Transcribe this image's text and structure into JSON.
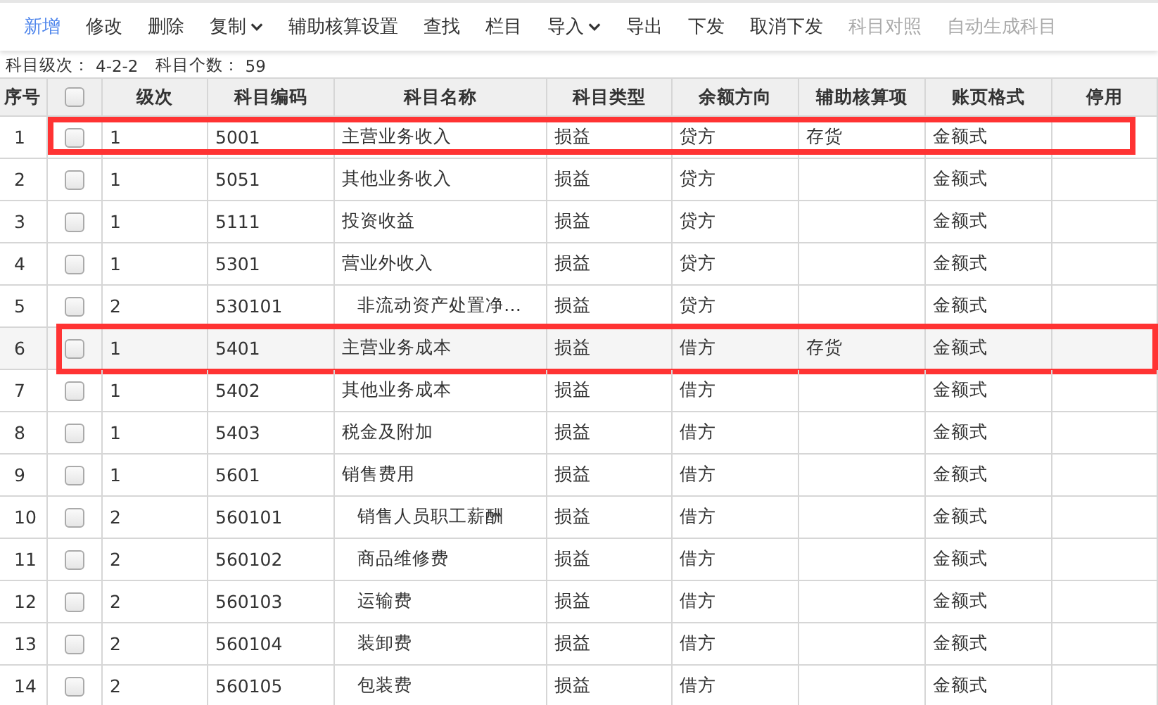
{
  "toolbar": [
    {
      "label": "新增",
      "selected": true,
      "disabled": false,
      "dropdown": false
    },
    {
      "label": "修改",
      "selected": false,
      "disabled": false,
      "dropdown": false
    },
    {
      "label": "删除",
      "selected": false,
      "disabled": false,
      "dropdown": false
    },
    {
      "label": "复制",
      "selected": false,
      "disabled": false,
      "dropdown": true
    },
    {
      "label": "辅助核算设置",
      "selected": false,
      "disabled": false,
      "dropdown": false
    },
    {
      "label": "查找",
      "selected": false,
      "disabled": false,
      "dropdown": false
    },
    {
      "label": "栏目",
      "selected": false,
      "disabled": false,
      "dropdown": false
    },
    {
      "label": "导入",
      "selected": false,
      "disabled": false,
      "dropdown": true
    },
    {
      "label": "导出",
      "selected": false,
      "disabled": false,
      "dropdown": false
    },
    {
      "label": "下发",
      "selected": false,
      "disabled": false,
      "dropdown": false
    },
    {
      "label": "取消下发",
      "selected": false,
      "disabled": false,
      "dropdown": false
    },
    {
      "label": "科目对照",
      "selected": false,
      "disabled": true,
      "dropdown": false
    },
    {
      "label": "自动生成科目",
      "selected": false,
      "disabled": true,
      "dropdown": false
    }
  ],
  "info": [
    {
      "label": "科目级次：",
      "value": "4-2-2"
    },
    {
      "label": "科目个数：",
      "value": "59"
    }
  ],
  "table": {
    "columns": [
      "序号",
      "级次",
      "科目编码",
      "科目名称",
      "科目类型",
      "余额方向",
      "辅助核算项",
      "账页格式",
      "停用"
    ],
    "header_checked": false,
    "rows": [
      {
        "no": "1",
        "checked": false,
        "level": "1",
        "code": "5001",
        "name": "主营业务收入",
        "indented": false,
        "type": "损益",
        "direction": "贷方",
        "aux": "存货",
        "format": "金额式",
        "highlighted": true,
        "hovered": false
      },
      {
        "no": "2",
        "checked": false,
        "level": "1",
        "code": "5051",
        "name": "其他业务收入",
        "indented": false,
        "type": "损益",
        "direction": "贷方",
        "aux": "",
        "format": "金额式",
        "highlighted": false,
        "hovered": false
      },
      {
        "no": "3",
        "checked": false,
        "level": "1",
        "code": "5111",
        "name": "投资收益",
        "indented": false,
        "type": "损益",
        "direction": "贷方",
        "aux": "",
        "format": "金额式",
        "highlighted": false,
        "hovered": false
      },
      {
        "no": "4",
        "checked": false,
        "level": "1",
        "code": "5301",
        "name": "营业外收入",
        "indented": false,
        "type": "损益",
        "direction": "贷方",
        "aux": "",
        "format": "金额式",
        "highlighted": false,
        "hovered": false
      },
      {
        "no": "5",
        "checked": false,
        "level": "2",
        "code": "530101",
        "name": "非流动资产处置净…",
        "indented": true,
        "type": "损益",
        "direction": "贷方",
        "aux": "",
        "format": "金额式",
        "highlighted": false,
        "hovered": false
      },
      {
        "no": "6",
        "checked": false,
        "level": "1",
        "code": "5401",
        "name": "主营业务成本",
        "indented": false,
        "type": "损益",
        "direction": "借方",
        "aux": "存货",
        "format": "金额式",
        "highlighted": true,
        "hovered": true
      },
      {
        "no": "7",
        "checked": false,
        "level": "1",
        "code": "5402",
        "name": "其他业务成本",
        "indented": false,
        "type": "损益",
        "direction": "借方",
        "aux": "",
        "format": "金额式",
        "highlighted": false,
        "hovered": false
      },
      {
        "no": "8",
        "checked": false,
        "level": "1",
        "code": "5403",
        "name": "税金及附加",
        "indented": false,
        "type": "损益",
        "direction": "借方",
        "aux": "",
        "format": "金额式",
        "highlighted": false,
        "hovered": false
      },
      {
        "no": "9",
        "checked": false,
        "level": "1",
        "code": "5601",
        "name": "销售费用",
        "indented": false,
        "type": "损益",
        "direction": "借方",
        "aux": "",
        "format": "金额式",
        "highlighted": false,
        "hovered": false
      },
      {
        "no": "10",
        "checked": false,
        "level": "2",
        "code": "560101",
        "name": "销售人员职工薪酬",
        "indented": true,
        "type": "损益",
        "direction": "借方",
        "aux": "",
        "format": "金额式",
        "highlighted": false,
        "hovered": false
      },
      {
        "no": "11",
        "checked": false,
        "level": "2",
        "code": "560102",
        "name": "商品维修费",
        "indented": true,
        "type": "损益",
        "direction": "借方",
        "aux": "",
        "format": "金额式",
        "highlighted": false,
        "hovered": false
      },
      {
        "no": "12",
        "checked": false,
        "level": "2",
        "code": "560103",
        "name": "运输费",
        "indented": true,
        "type": "损益",
        "direction": "借方",
        "aux": "",
        "format": "金额式",
        "highlighted": false,
        "hovered": false
      },
      {
        "no": "13",
        "checked": false,
        "level": "2",
        "code": "560104",
        "name": "装卸费",
        "indented": true,
        "type": "损益",
        "direction": "借方",
        "aux": "",
        "format": "金额式",
        "highlighted": false,
        "hovered": false
      },
      {
        "no": "14",
        "checked": false,
        "level": "2",
        "code": "560105",
        "name": "包装费",
        "indented": true,
        "type": "损益",
        "direction": "借方",
        "aux": "",
        "format": "金额式",
        "highlighted": false,
        "hovered": false
      }
    ]
  }
}
